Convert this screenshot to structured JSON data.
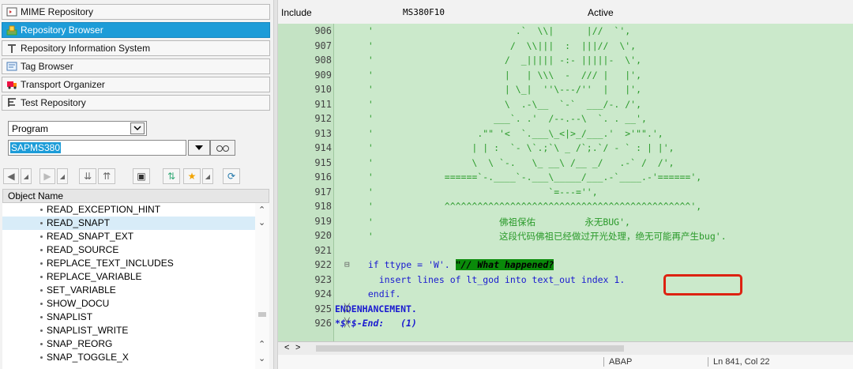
{
  "nav": {
    "mime": "MIME Repository",
    "browser": "Repository Browser",
    "info": "Repository Information System",
    "tag": "Tag Browser",
    "transport": "Transport Organizer",
    "test": "Test Repository"
  },
  "selector": {
    "type": "Program",
    "name": "SAPMS380"
  },
  "objects": {
    "header": "Object Name",
    "items": [
      "READ_EXCEPTION_HINT",
      "READ_SNAPT",
      "READ_SNAPT_EXT",
      "READ_SOURCE",
      "REPLACE_TEXT_INCLUDES",
      "REPLACE_VARIABLE",
      "SET_VARIABLE",
      "SHOW_DOCU",
      "SNAPLIST",
      "SNAPLIST_WRITE",
      "SNAP_REORG",
      "SNAP_TOGGLE_X"
    ]
  },
  "editor": {
    "kind": "Include",
    "name": "MS380F10",
    "state": "Active",
    "lines": [
      {
        "n": "906",
        "t": "  '                          .`  \\\\|      |//  `',"
      },
      {
        "n": "907",
        "t": "  '                         /  \\\\|||  :  |||//  \\',"
      },
      {
        "n": "908",
        "t": "  '                        /  _||||| -:- |||||-  \\',"
      },
      {
        "n": "909",
        "t": "  '                        |   | \\\\\\  -  /// |   |',"
      },
      {
        "n": "910",
        "t": "  '                        | \\_|  ''\\---/''  |   |',"
      },
      {
        "n": "911",
        "t": "  '                        \\  .-\\__  `-`  ___/-. /',"
      },
      {
        "n": "912",
        "t": "  '                      ___`. .'  /--.--\\  `. . __',"
      },
      {
        "n": "913",
        "t": "  '                   .\"\" '<  `.___\\_<|>_/___.'  >'\"\".',"
      },
      {
        "n": "914",
        "t": "  '                  | | :  `- \\`.;`\\ _ /`;.`/ - ` : | |',"
      },
      {
        "n": "915",
        "t": "  '                  \\  \\ `-.   \\_ __\\ /__ _/   .-` /  /',"
      },
      {
        "n": "916",
        "t": "  '             ======`-.____`-.___\\_____/___.-`____.-'======',"
      },
      {
        "n": "917",
        "t": "  '                                `=---='',"
      },
      {
        "n": "918",
        "t": "  '             ^^^^^^^^^^^^^^^^^^^^^^^^^^^^^^^^^^^^^^^^^^^^^',"
      },
      {
        "n": "919",
        "t": "  '                       佛祖保佑         永无BUG',"
      },
      {
        "n": "920",
        "t": "  '                       这段代码佛祖已经做过开光处理，绝无可能再产生bug'."
      },
      {
        "n": "921",
        "t": ""
      },
      {
        "n": "922",
        "t": "  if ttype = 'W'. "
      },
      {
        "n": "923",
        "t": "    insert lines of lt_god into text_out index 1."
      },
      {
        "n": "924",
        "t": "  endif."
      },
      {
        "n": "925",
        "t": "ENDENHANCEMENT."
      },
      {
        "n": "926",
        "t": "*$*$-End:   (1)"
      }
    ],
    "comment": "\"// What happened?"
  },
  "status": {
    "lang": "ABAP",
    "pos": "Ln 841, Col  22"
  }
}
